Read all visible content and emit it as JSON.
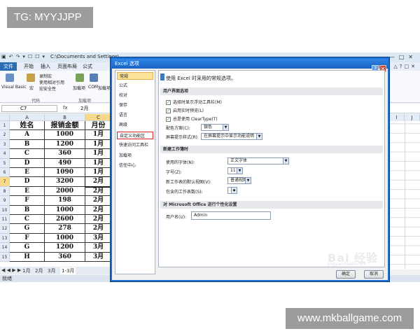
{
  "overlay": {
    "tag": "TG: MYYJJPP",
    "site": "www.mkballgame.com"
  },
  "excel": {
    "qat": [
      "▣",
      "↶",
      "↷",
      "▾",
      "☐",
      "☐",
      "▾"
    ],
    "path": "C:\\Documents and Settings\\...",
    "window_buttons": [
      "—",
      "□",
      "✕"
    ],
    "menu": {
      "file": "文件",
      "items": [
        "开始",
        "插入",
        "页面布局",
        "公式"
      ]
    },
    "ribbon": {
      "vba": "Visual Basic",
      "macro": "宏",
      "record": "录制宏",
      "relative": "使用相对引用",
      "security": "宏安全性",
      "code_group": "代码",
      "addins": "加载项",
      "com": "COM",
      "com_addins": "加载项",
      "addins_group": "加载项"
    },
    "formula_bar": {
      "name_box": "C7",
      "fx": "fx",
      "value": "2月"
    },
    "columns": [
      "A",
      "B",
      "C"
    ],
    "rows": [
      {
        "num": "1",
        "a": "姓名",
        "b": "报销金额",
        "c": "月份"
      },
      {
        "num": "2",
        "a": "A",
        "b": "1000",
        "c": "1月"
      },
      {
        "num": "3",
        "a": "B",
        "b": "1200",
        "c": "1月"
      },
      {
        "num": "4",
        "a": "C",
        "b": "360",
        "c": "1月"
      },
      {
        "num": "5",
        "a": "D",
        "b": "490",
        "c": "1月"
      },
      {
        "num": "6",
        "a": "E",
        "b": "1090",
        "c": "1月"
      },
      {
        "num": "7",
        "a": "D",
        "b": "3200",
        "c": "2月"
      },
      {
        "num": "8",
        "a": "E",
        "b": "2000",
        "c": "2月"
      },
      {
        "num": "9",
        "a": "F",
        "b": "198",
        "c": "2月"
      },
      {
        "num": "10",
        "a": "B",
        "b": "1000",
        "c": "2月"
      },
      {
        "num": "11",
        "a": "C",
        "b": "2600",
        "c": "2月"
      },
      {
        "num": "12",
        "a": "G",
        "b": "278",
        "c": "2月"
      },
      {
        "num": "13",
        "a": "F",
        "b": "1000",
        "c": "3月"
      },
      {
        "num": "14",
        "a": "G",
        "b": "1200",
        "c": "3月"
      },
      {
        "num": "15",
        "a": "H",
        "b": "360",
        "c": "3月"
      }
    ],
    "right_columns": [
      "I",
      "J"
    ],
    "sheet_tabs": [
      "1月",
      "2月",
      "3月",
      "1-3月"
    ],
    "sheet_nav": "◀ ◀ ▶ ▶",
    "status": "就绪"
  },
  "dialog": {
    "title": "Excel 选项",
    "help": "?",
    "close": "✕",
    "nav": [
      "常规",
      "公式",
      "校对",
      "保存",
      "语言",
      "高级",
      "自定义功能区",
      "快速访问工具栏",
      "加载项",
      "信任中心"
    ],
    "selected_index": 0,
    "circled_index": 6,
    "intro": "使用 Excel 时采用的常规选项。",
    "ui_section": "用户界面选项",
    "check1": "选择时显示浮动工具栏(M)",
    "check2": "启用实时预览(L)",
    "check3": "总是使用 ClearType(T)",
    "color_label": "配色方案(C):",
    "color_value": "银色",
    "tip_label": "屏幕提示样式(R):",
    "tip_value": "在屏幕提示中显示功能说明",
    "new_section": "新建工作簿时",
    "font_label": "使用的字体(N):",
    "font_value": "正文字体",
    "size_label": "字号(Z):",
    "size_value": "11",
    "view_label": "新工作表的默认视图(V):",
    "view_value": "普通视图",
    "sheets_label": "包含的工作表数(S):",
    "sheets_value": "3",
    "personal_section": "对 Microsoft Office 进行个性化设置",
    "user_label": "用户名(U):",
    "user_value": "Admin",
    "ok": "确定",
    "cancel": "取消"
  },
  "baidu": {
    "logo": "Bai 经验",
    "url": "jingyan.baidu.com"
  }
}
